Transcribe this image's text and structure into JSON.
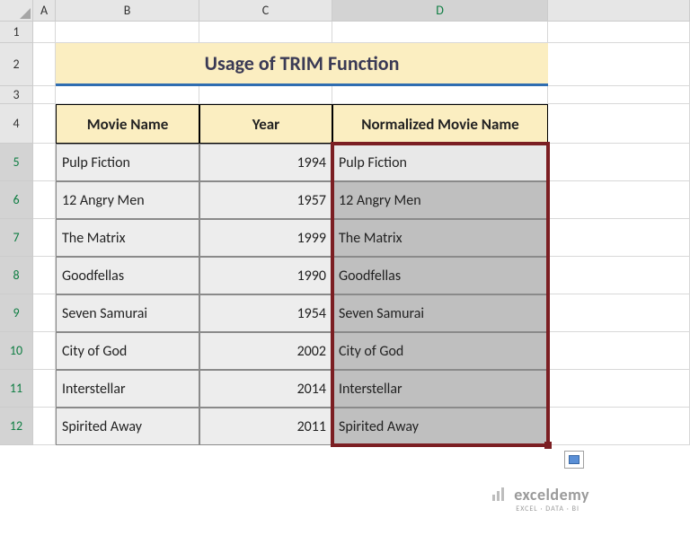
{
  "columns": [
    "A",
    "B",
    "C",
    "D"
  ],
  "rows": [
    "1",
    "2",
    "3",
    "4",
    "5",
    "6",
    "7",
    "8",
    "9",
    "10",
    "11",
    "12"
  ],
  "selected_col_index": 3,
  "selected_row_start": 4,
  "selected_row_end": 11,
  "title": "Usage of TRIM Function",
  "headers": {
    "movie": "Movie Name",
    "year": "Year",
    "normalized": "Normalized Movie Name"
  },
  "data": [
    {
      "movie": " Pulp  Fiction",
      "year": "1994",
      "normalized": "Pulp Fiction"
    },
    {
      "movie": " 12 Angry Men",
      "year": "1957",
      "normalized": "12 Angry Men"
    },
    {
      "movie": "The Matrix",
      "year": "1999",
      "normalized": "The Matrix"
    },
    {
      "movie": " Goodfellas",
      "year": "1990",
      "normalized": "Goodfellas"
    },
    {
      "movie": "Seven Samurai",
      "year": "1954",
      "normalized": "Seven Samurai"
    },
    {
      "movie": " City of God",
      "year": "2002",
      "normalized": "City of God"
    },
    {
      "movie": "Interstellar",
      "year": "2014",
      "normalized": "Interstellar"
    },
    {
      "movie": " Spirited Away",
      "year": "2011",
      "normalized": "Spirited Away"
    }
  ],
  "watermark": {
    "text": "exceldemy",
    "sub": "EXCEL · DATA · BI"
  }
}
